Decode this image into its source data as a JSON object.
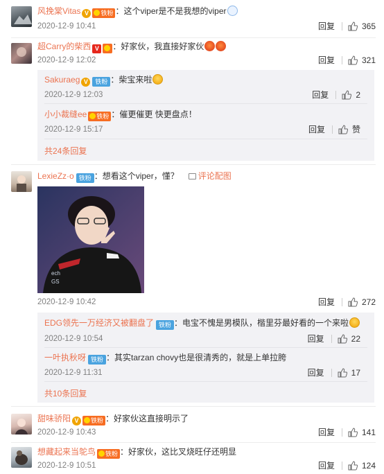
{
  "common": {
    "reply": "回复"
  },
  "comments": [
    {
      "user": "风挽棠Vitas",
      "text": "：这个viper是不是我想的viper",
      "time": "2020-12-9 10:41",
      "likes": "365",
      "fans_badge": "铁粉"
    },
    {
      "user": "超Carry的柴西",
      "text": "：好家伙，我直接好家伙",
      "time": "2020-12-9 12:02",
      "likes": "321"
    },
    {
      "user": "LexieZz·o",
      "text": "：想看这个viper，懂？",
      "time": "2020-12-9 10:42",
      "likes": "272",
      "fans_badge": "铁粉",
      "pic_link": "评论配图"
    },
    {
      "user": "甜味骄阳",
      "text": "：好家伙这直接明示了",
      "time": "2020-12-9 10:43",
      "likes": "141",
      "fans_badge": "铁粉"
    },
    {
      "user": "想藏起来当鸵鸟",
      "text": "：好家伙，这比叉烧旺仔还明显",
      "time": "2020-12-9 10:51",
      "likes": "124",
      "fans_badge": "铁粉"
    }
  ],
  "replies_1": [
    {
      "user": "Sakuraeg",
      "text": "：柴宝来啦",
      "time": "2020-12-9 12:03",
      "likes": "2",
      "fans_badge": "铁粉"
    },
    {
      "user": "小小裁缝ee",
      "text": "：催更催更 快更盘点！",
      "time": "2020-12-9 15:17",
      "likes": "赞",
      "fans_badge": "铁粉"
    }
  ],
  "more_1": "共24条回复",
  "replies_2": [
    {
      "user": "EDG领先一万经济又被翻盘了",
      "text": "：电宝不愧是男模队，楷里芬最好看的一个来啦",
      "time": "2020-12-9 10:54",
      "likes": "22",
      "fans_badge": "铁粉"
    },
    {
      "user": "一叶执秋呀",
      "text": "：其实tarzan chovy也是很清秀的，就是上单拉胯",
      "time": "2020-12-9 11:31",
      "likes": "17",
      "fans_badge": "铁粉"
    }
  ],
  "more_2": "共10条回复",
  "colors": {
    "username": "#eb7350",
    "meta": "#808080",
    "subbox": "#f2f2f5"
  },
  "icons": {
    "like": "thumbs-up-icon",
    "pic": "image-icon",
    "verified": "v-badge-icon"
  }
}
